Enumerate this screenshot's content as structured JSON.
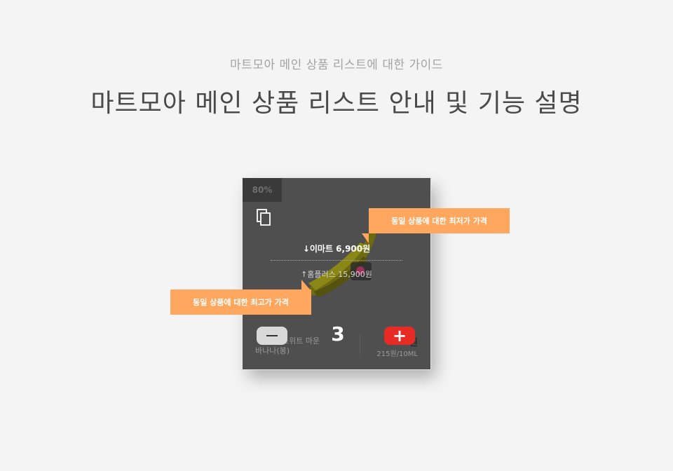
{
  "header": {
    "subtitle": "마트모아 메인 상품 리스트에 대한 가이드",
    "title": "마트모아 메인 상품 리스트 안내 및 기능 설명"
  },
  "card": {
    "discount_badge": "80%",
    "lowest_price": "↓이마트  6,900원",
    "highest_price": "↑홈플러스  15,900원",
    "product_name_line1": "스위트 마운",
    "product_name_line2": "바나나(봉)",
    "quantity": "3",
    "price": "원",
    "unit_price": "215원/10ML",
    "minus_icon": "minus-icon",
    "plus_icon": "plus-icon",
    "copy_icon": "copy-icon",
    "colors": {
      "card_bg": "#4f4f4f",
      "plus_button": "#e82a24",
      "minus_button": "#d9d9d9"
    }
  },
  "callouts": {
    "lowest_price_label": "동일 상품에 대한 최저가 가격",
    "highest_price_label": "동일 상품에 대한 최고가 가격",
    "color": "#ffa75f"
  }
}
